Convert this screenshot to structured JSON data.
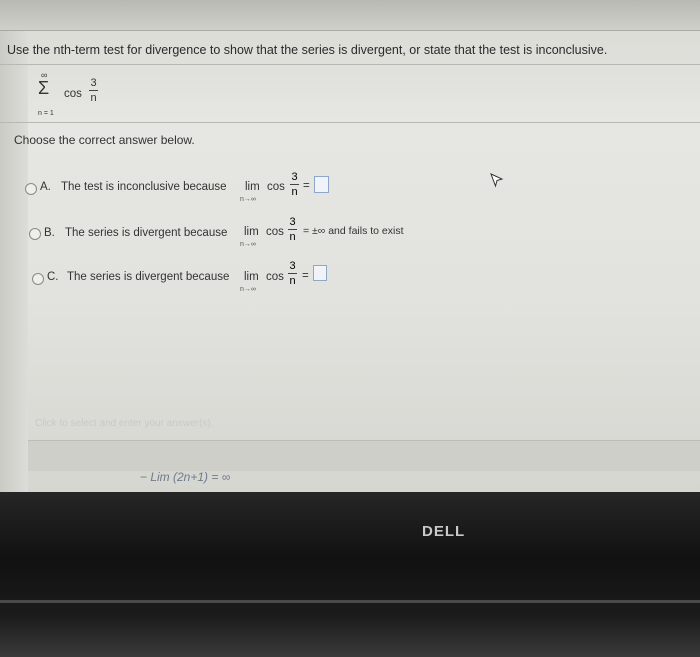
{
  "question": "Use the nth-term test for divergence to show that the series is divergent, or state that the test is inconclusive.",
  "series": {
    "sigma": "Σ",
    "upper": "∞",
    "lower": "n = 1",
    "func": "cos",
    "numerator": "3",
    "denominator": "n"
  },
  "prompt": "Choose the correct answer below.",
  "options": [
    {
      "letter": "A.",
      "text": "The test is inconclusive because",
      "lim": "lim",
      "func": "cos",
      "numerator": "3",
      "denominator": "n",
      "under": "n→∞",
      "tail": "="
    },
    {
      "letter": "B.",
      "text": "The series is divergent because",
      "lim": "lim",
      "func": "cos",
      "numerator": "3",
      "denominator": "n",
      "under": "n→∞",
      "tail": "= ±∞ and fails to exist"
    },
    {
      "letter": "C.",
      "text": "The series is divergent because",
      "lim": "lim",
      "func": "cos",
      "numerator": "3",
      "denominator": "n",
      "under": "n→∞",
      "tail": "="
    }
  ],
  "hint": "Click to select and enter your answer(s).",
  "handwriting": "− Lim (2n+1)   = ∞",
  "brand": "DELL",
  "colors": {
    "screen": "#e2e2de",
    "bezel": "#151515",
    "answer_box": "#8fa6c8"
  }
}
